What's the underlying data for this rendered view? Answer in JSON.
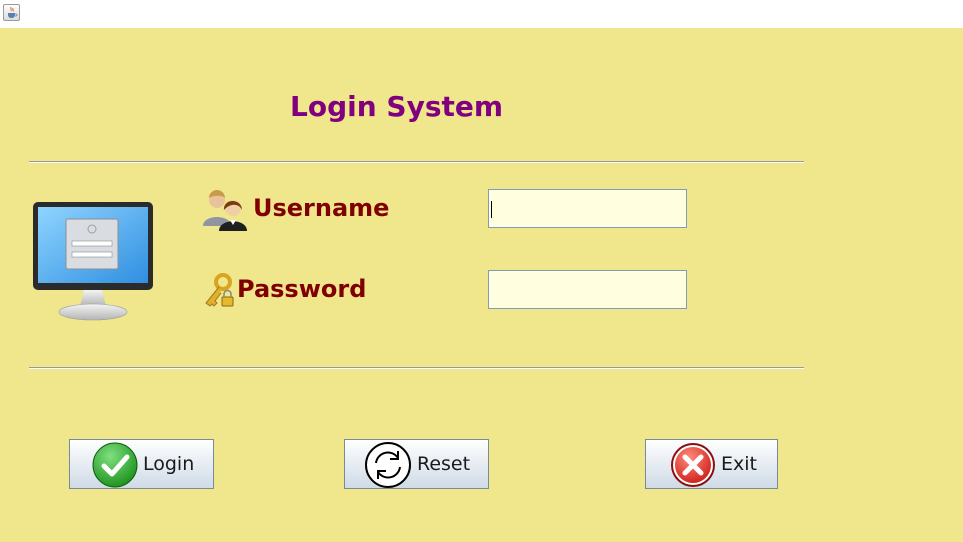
{
  "window": {
    "app_icon": "java-coffee-cup-icon"
  },
  "header": {
    "title": "Login System"
  },
  "form": {
    "username_label": "Username",
    "username_value": "",
    "username_icon": "users-icon",
    "password_label": "Password",
    "password_value": "",
    "password_icon": "key-lock-icon",
    "illustration": "monitor-login-icon"
  },
  "buttons": {
    "login": "Login",
    "login_icon": "checkmark-icon",
    "reset": "Reset",
    "reset_icon": "refresh-icon",
    "exit": "Exit",
    "exit_icon": "close-x-icon"
  },
  "colors": {
    "background": "#f0e68c",
    "title": "#800080",
    "label": "#800000",
    "input_bg": "#ffffe0"
  }
}
